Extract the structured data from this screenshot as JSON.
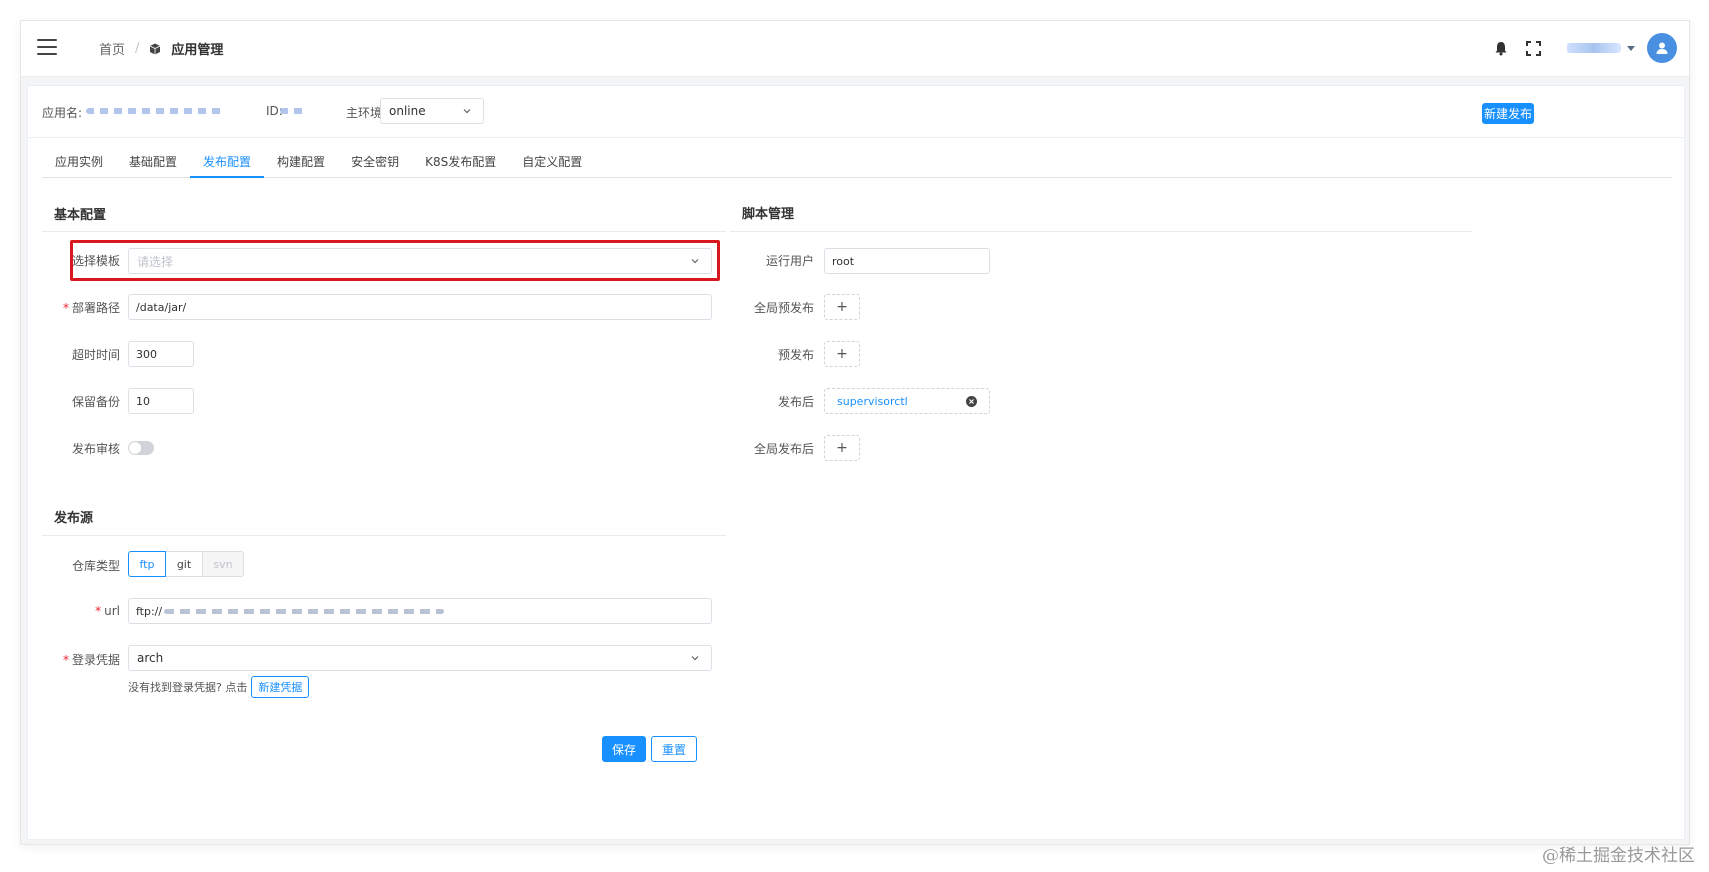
{
  "breadcrumb": {
    "home": "首页",
    "current": "应用管理"
  },
  "app_info": {
    "name_label": "应用名:",
    "id_label": "ID:",
    "env_label": "主环境:",
    "env_value": "online",
    "new_release_button": "新建发布"
  },
  "tabs": [
    {
      "label": "应用实例",
      "active": false
    },
    {
      "label": "基础配置",
      "active": false
    },
    {
      "label": "发布配置",
      "active": true
    },
    {
      "label": "构建配置",
      "active": false
    },
    {
      "label": "安全密钥",
      "active": false
    },
    {
      "label": "K8S发布配置",
      "active": false
    },
    {
      "label": "自定义配置",
      "active": false
    }
  ],
  "basic_config": {
    "title": "基本配置",
    "template_label": "选择模板",
    "template_placeholder": "请选择",
    "deploy_path_label": "部署路径",
    "deploy_path_value": "/data/jar/",
    "timeout_label": "超时时间",
    "timeout_value": "300",
    "backup_label": "保留备份",
    "backup_value": "10",
    "review_label": "发布审核",
    "review_enabled": false
  },
  "script_mgmt": {
    "title": "脚本管理",
    "run_user_label": "运行用户",
    "run_user_value": "root",
    "global_pre_label": "全局预发布",
    "pre_label": "预发布",
    "post_label": "发布后",
    "post_tag": "supervisorctl",
    "global_post_label": "全局发布后",
    "add_symbol": "+"
  },
  "release_source": {
    "title": "发布源",
    "repo_type_label": "仓库类型",
    "repo_types": [
      {
        "label": "ftp",
        "state": "active"
      },
      {
        "label": "git",
        "state": "normal"
      },
      {
        "label": "svn",
        "state": "disabled"
      }
    ],
    "url_label": "url",
    "url_prefix": "ftp://",
    "credential_label": "登录凭据",
    "credential_value": "arch",
    "hint_text": "没有找到登录凭据? 点击",
    "new_credential_button": "新建凭据"
  },
  "actions": {
    "save": "保存",
    "reset": "重置"
  },
  "watermark": "@稀土掘金技术社区",
  "colors": {
    "accent": "#1890ff",
    "highlight": "#d9171f",
    "required": "#f5222d"
  }
}
